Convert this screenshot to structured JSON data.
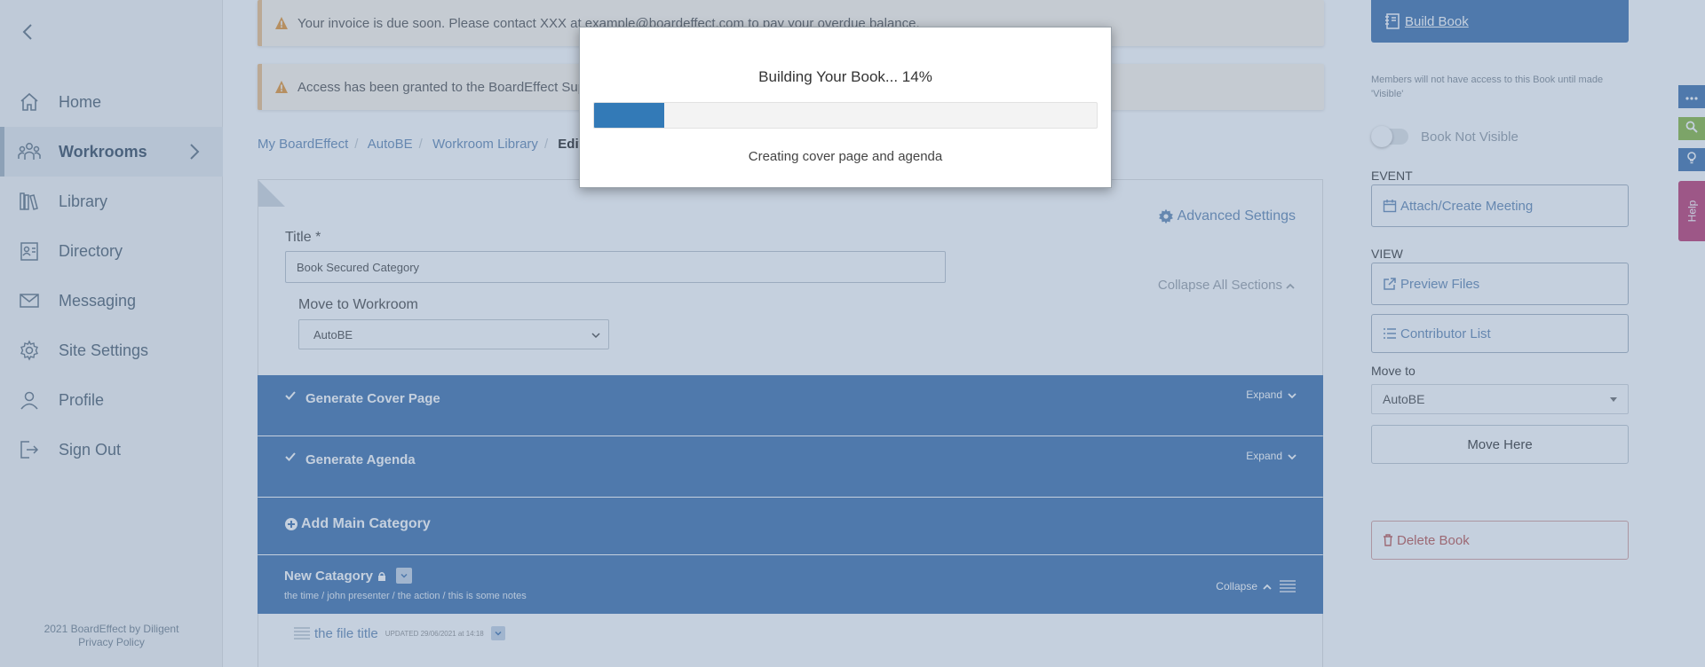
{
  "sidebar": {
    "items": [
      {
        "label": "Home",
        "icon": "home-icon"
      },
      {
        "label": "Workrooms",
        "icon": "users-icon",
        "active": true
      },
      {
        "label": "Library",
        "icon": "books-icon"
      },
      {
        "label": "Directory",
        "icon": "contact-card-icon"
      },
      {
        "label": "Messaging",
        "icon": "envelope-icon"
      },
      {
        "label": "Site Settings",
        "icon": "gear-icon"
      },
      {
        "label": "Profile",
        "icon": "person-icon"
      },
      {
        "label": "Sign Out",
        "icon": "sign-out-icon"
      }
    ],
    "footer": {
      "copyright": "2021 BoardEffect by Diligent",
      "privacy": "Privacy Policy"
    }
  },
  "alerts": {
    "invoice": "Your invoice is due soon. Please contact XXX at example@boardeffect.com to pay your overdue balance.",
    "access": "Access has been granted to the BoardEffect Support Team"
  },
  "breadcrumb": [
    "My BoardEffect",
    "AutoBE",
    "Workroom Library",
    "Edit Book"
  ],
  "editor": {
    "advanced_settings": "Advanced Settings",
    "title_label": "Title *",
    "title_value": "Book Secured Category",
    "move_label": "Move to Workroom",
    "move_value": "AutoBE",
    "collapse_all": "Collapse All Sections"
  },
  "sections": {
    "cover": {
      "label": "Generate Cover Page",
      "action": "Expand"
    },
    "agenda": {
      "label": "Generate Agenda",
      "action": "Expand"
    },
    "add_main": "Add Main Category",
    "category": {
      "label": "New Catagory",
      "subtitle": "the time / john presenter / the action / this is some notes",
      "action": "Collapse"
    },
    "file": {
      "title": "the file title",
      "updated": "UPDATED 29/06/2021 at 14:18"
    }
  },
  "right_panel": {
    "build_book": "Build Book",
    "visibility_note": "Members will not have access to this Book until made 'Visible'",
    "visibility_toggle": "Book Not Visible",
    "event_heading": "EVENT",
    "attach_meeting": "Attach/Create Meeting",
    "view_heading": "VIEW",
    "preview_files": "Preview Files",
    "contributor_list": "Contributor List",
    "move_to_heading": "Move to",
    "move_to_value": "AutoBE",
    "move_here": "Move Here",
    "delete_book": "Delete Book"
  },
  "side_tabs": {
    "help": "Help"
  },
  "modal": {
    "title": "Building Your Book... 14%",
    "progress": 0.14,
    "status": "Creating cover page and agenda"
  },
  "colors": {
    "primary": "#4a7ab3",
    "progress": "#337ab7",
    "alert_border": "#f0c48f",
    "link": "#6c8fb8",
    "danger": "#c0615c",
    "help_tab": "#c2467a",
    "success_tab": "#8fbc4a"
  }
}
